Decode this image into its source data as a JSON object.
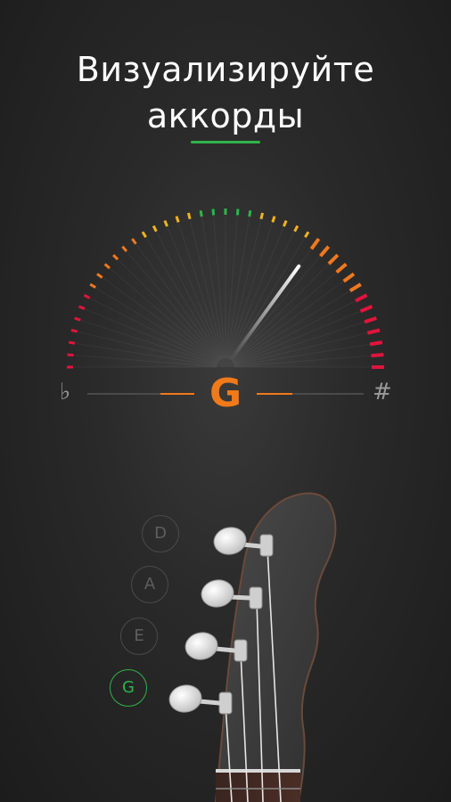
{
  "headline": {
    "line1": "Визуализируйте",
    "line2": "аккорды"
  },
  "tuner": {
    "note": "G",
    "flat_symbol": "♭",
    "sharp_symbol": "#",
    "needle_position": 0.7
  },
  "strings": [
    {
      "label": "D",
      "active": false
    },
    {
      "label": "A",
      "active": false
    },
    {
      "label": "E",
      "active": false
    },
    {
      "label": "G",
      "active": true
    }
  ],
  "colors": {
    "accent_green": "#2fb34a",
    "note_orange": "#f07a1a",
    "gauge_red": "#e0143c",
    "gauge_orange": "#f0781e",
    "gauge_yellow": "#f0b41e",
    "gauge_green": "#2fb34a",
    "background": "#262626"
  },
  "icons": {
    "flat": "flat-icon",
    "sharp": "sharp-icon",
    "headstock": "guitar-headstock-icon"
  }
}
